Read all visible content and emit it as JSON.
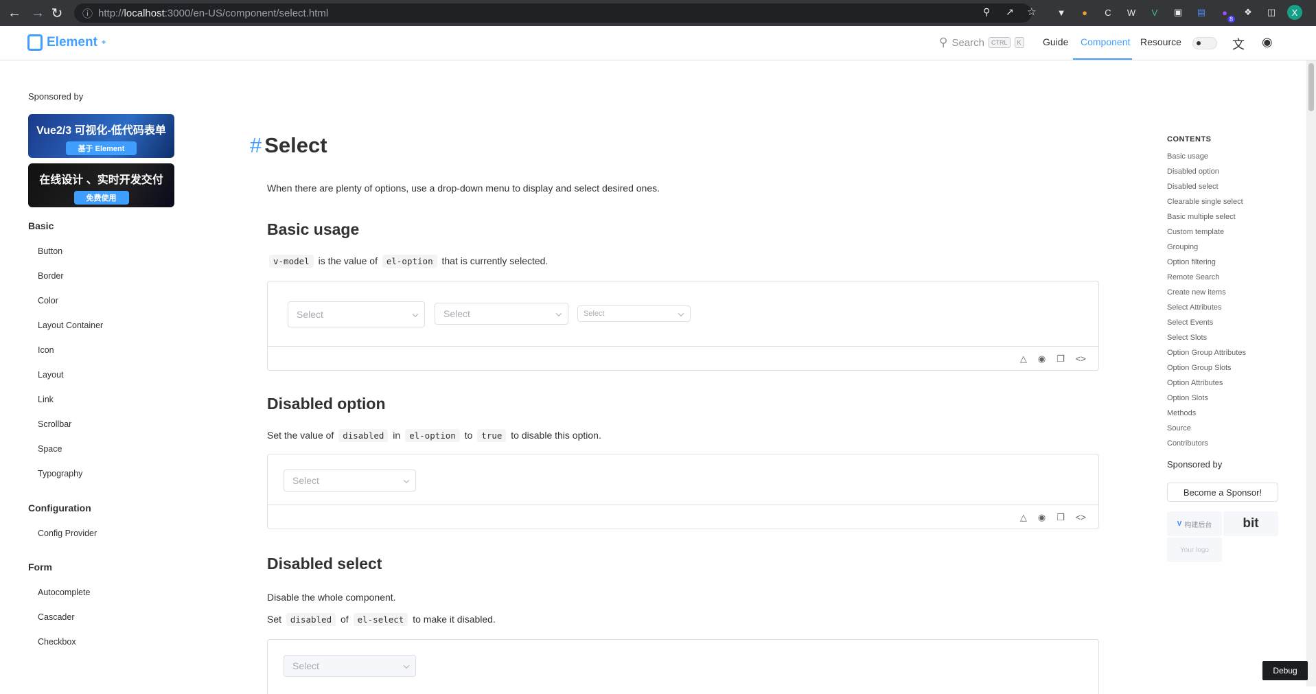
{
  "browser": {
    "url_prefix": "http://",
    "url_host": "localhost",
    "url_rest": ":3000/en-US/component/select.html",
    "profile_initial": "X",
    "badge_count": "8"
  },
  "topnav": {
    "logo_text": "Element",
    "logo_sup": "+",
    "search_label": "Search",
    "kbd_ctrl": "CTRL",
    "kbd_k": "K",
    "links": [
      "Guide",
      "Component",
      "Resource"
    ]
  },
  "sidebar": {
    "sponsored_by": "Sponsored by",
    "banner1_title": "Vue2/3 可视化-低代码表单",
    "banner1_pill": "基于 Element",
    "banner2_title": "在线设计 、实时开发交付",
    "banner2_pill": "免费使用",
    "groups": {
      "basic": "Basic",
      "configuration": "Configuration",
      "form": "Form"
    },
    "basic_items": [
      "Button",
      "Border",
      "Color",
      "Layout Container",
      "Icon",
      "Layout",
      "Link",
      "Scrollbar",
      "Space",
      "Typography"
    ],
    "config_items": [
      "Config Provider"
    ],
    "form_items": [
      "Autocomplete",
      "Cascader",
      "Checkbox"
    ]
  },
  "main": {
    "hash": "#",
    "title": "Select",
    "intro": "When there are plenty of options, use a drop-down menu to display and select desired ones.",
    "basic_usage": {
      "heading": "Basic usage",
      "code1": "v-model",
      "text1": "is the value of",
      "code2": "el-option",
      "text2": "that is currently selected.",
      "select_placeholder": "Select"
    },
    "disabled_option": {
      "heading": "Disabled option",
      "text1": "Set the value of",
      "code1": "disabled",
      "text2": "in",
      "code2": "el-option",
      "text3": "to",
      "code3": "true",
      "text4": "to disable this option.",
      "select_placeholder": "Select"
    },
    "disabled_select": {
      "heading": "Disabled select",
      "intro": "Disable the whole component.",
      "text1": "Set",
      "code1": "disabled",
      "text2": "of",
      "code2": "el-select",
      "text3": "to make it disabled.",
      "select_placeholder": "Select"
    }
  },
  "toc": {
    "title": "CONTENTS",
    "items": [
      "Basic usage",
      "Disabled option",
      "Disabled select",
      "Clearable single select",
      "Basic multiple select",
      "Custom template",
      "Grouping",
      "Option filtering",
      "Remote Search",
      "Create new items",
      "Select Attributes",
      "Select Events",
      "Select Slots",
      "Option Group Attributes",
      "Option Group Slots",
      "Option Attributes",
      "Option Slots",
      "Methods",
      "Source",
      "Contributors"
    ],
    "sponsored_by": "Sponsored by",
    "become_sponsor": "Become a Sponsor!",
    "sponsor1": "构建后台",
    "sponsor2": "bit",
    "your_logo": "Your logo"
  },
  "debug_label": "Debug"
}
